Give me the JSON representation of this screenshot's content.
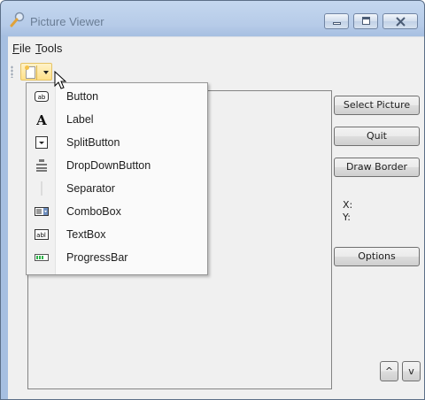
{
  "window": {
    "title": "Picture Viewer"
  },
  "caption_buttons": {
    "minimize": "minimize-icon",
    "maximize": "maximize-icon",
    "close": "close-icon"
  },
  "menu": {
    "file": {
      "mnemonic": "F",
      "rest": "ile"
    },
    "tools": {
      "mnemonic": "T",
      "rest": "ools"
    }
  },
  "toolstrip": {
    "add_item_button": "new-item-icon"
  },
  "dropdown": {
    "items": [
      {
        "label": "Button",
        "icon": "button-icon"
      },
      {
        "label": "Label",
        "icon": "label-icon"
      },
      {
        "label": "SplitButton",
        "icon": "splitbutton-icon"
      },
      {
        "label": "DropDownButton",
        "icon": "dropdownbutton-icon"
      },
      {
        "label": "Separator",
        "icon": "separator-icon"
      },
      {
        "label": "ComboBox",
        "icon": "combobox-icon"
      },
      {
        "label": "TextBox",
        "icon": "textbox-icon"
      },
      {
        "label": "ProgressBar",
        "icon": "progressbar-icon"
      }
    ]
  },
  "buttons": {
    "select_picture": "Select Picture",
    "quit": "Quit",
    "draw_border": "Draw Border",
    "options": "Options",
    "up": "^",
    "down": "v"
  },
  "coords": {
    "x_label": "X:",
    "y_label": "Y:"
  },
  "colors": {
    "titlebar": "#b6cbe8",
    "client": "#f0f0f0",
    "toolstrip_highlight": "#ffe08a"
  }
}
